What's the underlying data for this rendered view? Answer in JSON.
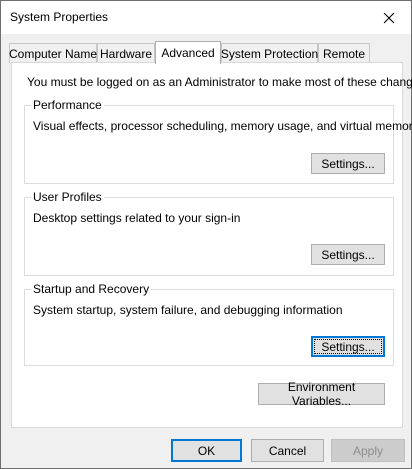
{
  "window": {
    "title": "System Properties"
  },
  "tabs": [
    {
      "label": "Computer Name",
      "active": false
    },
    {
      "label": "Hardware",
      "active": false
    },
    {
      "label": "Advanced",
      "active": true
    },
    {
      "label": "System Protection",
      "active": false
    },
    {
      "label": "Remote",
      "active": false
    }
  ],
  "advanced": {
    "admin_note": "You must be logged on as an Administrator to make most of these changes.",
    "performance": {
      "legend": "Performance",
      "description": "Visual effects, processor scheduling, memory usage, and virtual memory",
      "button": "Settings..."
    },
    "user_profiles": {
      "legend": "User Profiles",
      "description": "Desktop settings related to your sign-in",
      "button": "Settings..."
    },
    "startup_recovery": {
      "legend": "Startup and Recovery",
      "description": "System startup, system failure, and debugging information",
      "button": "Settings..."
    },
    "env_button": "Environment Variables..."
  },
  "footer": {
    "ok": "OK",
    "cancel": "Cancel",
    "apply": "Apply"
  },
  "icons": {
    "close": "close-icon"
  },
  "colors": {
    "accent": "#0078d7"
  }
}
